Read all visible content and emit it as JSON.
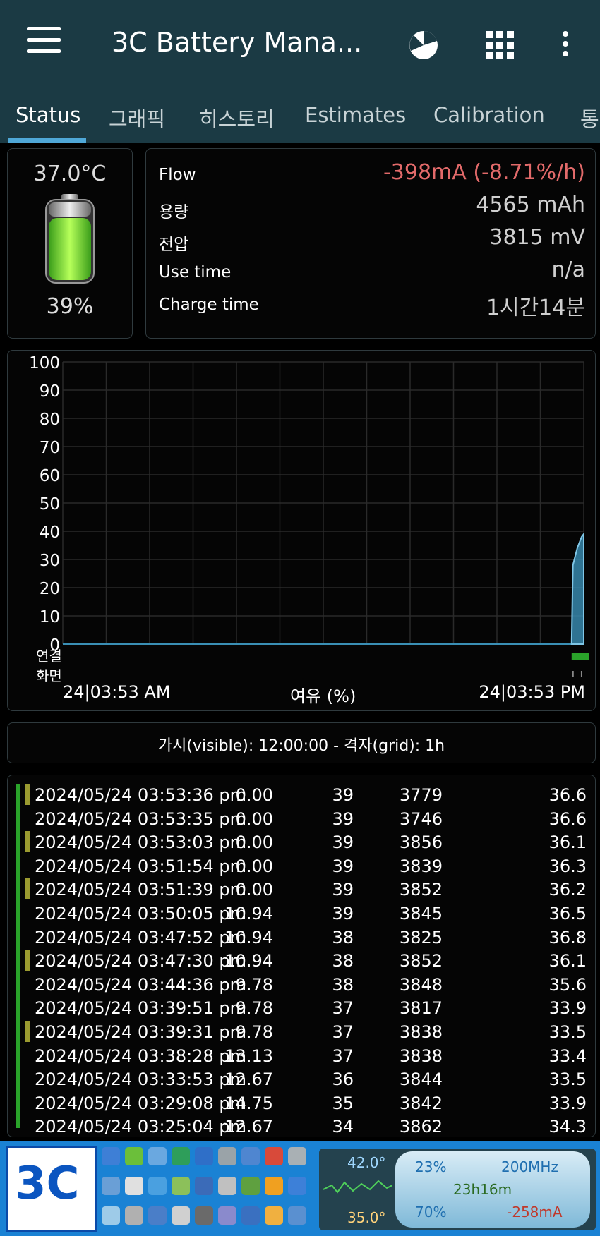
{
  "appbar": {
    "title": "3C Battery Mana...",
    "menu_icon": "hamburger-menu-icon",
    "chart_icon": "pie-chart-icon",
    "grid_icon": "apps-grid-icon",
    "overflow_icon": "more-vert-icon"
  },
  "tabs": [
    "Status",
    "그래픽",
    "히스토리",
    "Estimates",
    "Calibration",
    "통"
  ],
  "battery": {
    "temperature": "37.0°C",
    "percent": "39%"
  },
  "info": [
    {
      "label": "Flow",
      "value": "-398mA (-8.71%/h)"
    },
    {
      "label": "용량",
      "value": "4565 mAh"
    },
    {
      "label": "전압",
      "value": "3815 mV"
    },
    {
      "label": "Use time",
      "value": "n/a"
    },
    {
      "label": "Charge time",
      "value": "1시간14분"
    }
  ],
  "chart_data": {
    "type": "area",
    "yticks": [
      "100",
      "90",
      "80",
      "70",
      "60",
      "50",
      "40",
      "30",
      "20",
      "10",
      "0"
    ],
    "ylim": [
      0,
      100
    ],
    "row_labels": [
      "연결",
      "화면"
    ],
    "x_start_label": "24|03:53 AM",
    "x_end_label": "24|03:53 PM",
    "xlabel": "여유 (%)",
    "series": [
      {
        "x": [
          11.72,
          11.75,
          11.8,
          11.85,
          11.9,
          11.95,
          12.0
        ],
        "values": [
          0,
          28,
          31,
          34,
          36,
          38,
          39
        ]
      }
    ],
    "color": "#3a8fb5"
  },
  "visible_bar": "가시(visible): 12:00:00 - 격자(grid): 1h",
  "log": [
    {
      "mark": true,
      "datetime": "2024/05/24  03:53:36 pm",
      "flow": "0.00",
      "level": "39",
      "mv": "3779",
      "temp": "36.6"
    },
    {
      "mark": false,
      "datetime": "2024/05/24  03:53:35 pm",
      "flow": "0.00",
      "level": "39",
      "mv": "3746",
      "temp": "36.6"
    },
    {
      "mark": true,
      "datetime": "2024/05/24  03:53:03 pm",
      "flow": "0.00",
      "level": "39",
      "mv": "3856",
      "temp": "36.1"
    },
    {
      "mark": false,
      "datetime": "2024/05/24  03:51:54 pm",
      "flow": "0.00",
      "level": "39",
      "mv": "3839",
      "temp": "36.3"
    },
    {
      "mark": true,
      "datetime": "2024/05/24  03:51:39 pm",
      "flow": "0.00",
      "level": "39",
      "mv": "3852",
      "temp": "36.2"
    },
    {
      "mark": false,
      "datetime": "2024/05/24  03:50:05 pm",
      "flow": "10.94",
      "level": "39",
      "mv": "3845",
      "temp": "36.5"
    },
    {
      "mark": false,
      "datetime": "2024/05/24  03:47:52 pm",
      "flow": "10.94",
      "level": "38",
      "mv": "3825",
      "temp": "36.8"
    },
    {
      "mark": true,
      "datetime": "2024/05/24  03:47:30 pm",
      "flow": "10.94",
      "level": "38",
      "mv": "3852",
      "temp": "36.1"
    },
    {
      "mark": false,
      "datetime": "2024/05/24  03:44:36 pm",
      "flow": "9.78",
      "level": "38",
      "mv": "3848",
      "temp": "35.6"
    },
    {
      "mark": false,
      "datetime": "2024/05/24  03:39:51 pm",
      "flow": "9.78",
      "level": "37",
      "mv": "3817",
      "temp": "33.9"
    },
    {
      "mark": true,
      "datetime": "2024/05/24  03:39:31 pm",
      "flow": "9.78",
      "level": "37",
      "mv": "3838",
      "temp": "33.5"
    },
    {
      "mark": false,
      "datetime": "2024/05/24  03:38:28 pm",
      "flow": "13.13",
      "level": "37",
      "mv": "3838",
      "temp": "33.4"
    },
    {
      "mark": false,
      "datetime": "2024/05/24  03:33:53 pm",
      "flow": "12.67",
      "level": "36",
      "mv": "3844",
      "temp": "33.5"
    },
    {
      "mark": false,
      "datetime": "2024/05/24  03:29:08 pm",
      "flow": "14.75",
      "level": "35",
      "mv": "3842",
      "temp": "33.9"
    },
    {
      "mark": false,
      "datetime": "2024/05/24  03:25:04 pm",
      "flow": "12.67",
      "level": "34",
      "mv": "3862",
      "temp": "34.3"
    }
  ],
  "ad": {
    "logo_text": "3C",
    "temp_top": "42.0°",
    "temp_bottom": "35.0°",
    "cpu": "23%",
    "freq": "200MHz",
    "uptime": "23h16m",
    "mem": "70%",
    "current": "-258mA"
  }
}
